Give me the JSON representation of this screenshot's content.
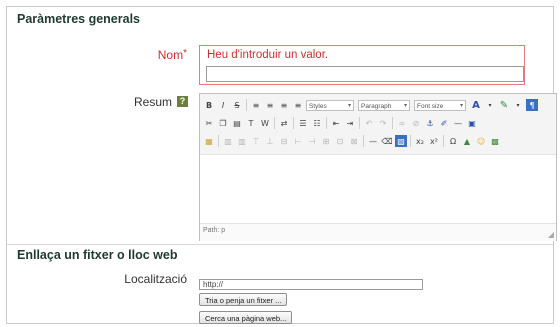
{
  "general_section": {
    "title": "Paràmetres generals",
    "name_label": "Nom",
    "required_marker": "*",
    "name_error": "Heu d'introduir un valor.",
    "name_value": "",
    "summary_label": "Resum",
    "help_icon": "help-icon",
    "editor": {
      "styles_label": "Styles",
      "paragraph_label": "Paragraph",
      "fontsize_label": "Font size",
      "path_label": "Path: p"
    }
  },
  "link_section": {
    "title": "Enllaça un fitxer o lloc web",
    "location_label": "Localització",
    "location_value": "http://",
    "choose_file_button": "Tria o penja un fitxer ...",
    "search_web_button": "Cerca una pàgina web..."
  },
  "colors": {
    "error": "#cc2f2f",
    "heading": "#1f3a2f"
  }
}
